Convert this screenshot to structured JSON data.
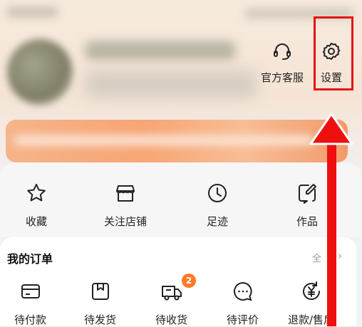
{
  "header": {
    "customer_service_label": "官方客服",
    "settings_label": "设置",
    "customer_service_icon": "headset-icon",
    "settings_icon": "gear-icon"
  },
  "quick_links": [
    {
      "label": "收藏",
      "icon": "star-icon"
    },
    {
      "label": "关注店铺",
      "icon": "shop-icon"
    },
    {
      "label": "足迹",
      "icon": "clock-icon"
    },
    {
      "label": "作品",
      "icon": "edit-icon"
    }
  ],
  "orders": {
    "title": "我的订单",
    "all_label": "全",
    "items": [
      {
        "label": "待付款",
        "icon": "wallet-icon"
      },
      {
        "label": "待发货",
        "icon": "package-icon"
      },
      {
        "label": "待收货",
        "icon": "truck-icon",
        "badge": "2"
      },
      {
        "label": "待评价",
        "icon": "chat-icon"
      },
      {
        "label": "退款/售后",
        "icon": "refund-icon"
      }
    ]
  },
  "colors": {
    "highlight": "#e41414",
    "badge": "#ff7a29",
    "banner": "#f7a574"
  }
}
